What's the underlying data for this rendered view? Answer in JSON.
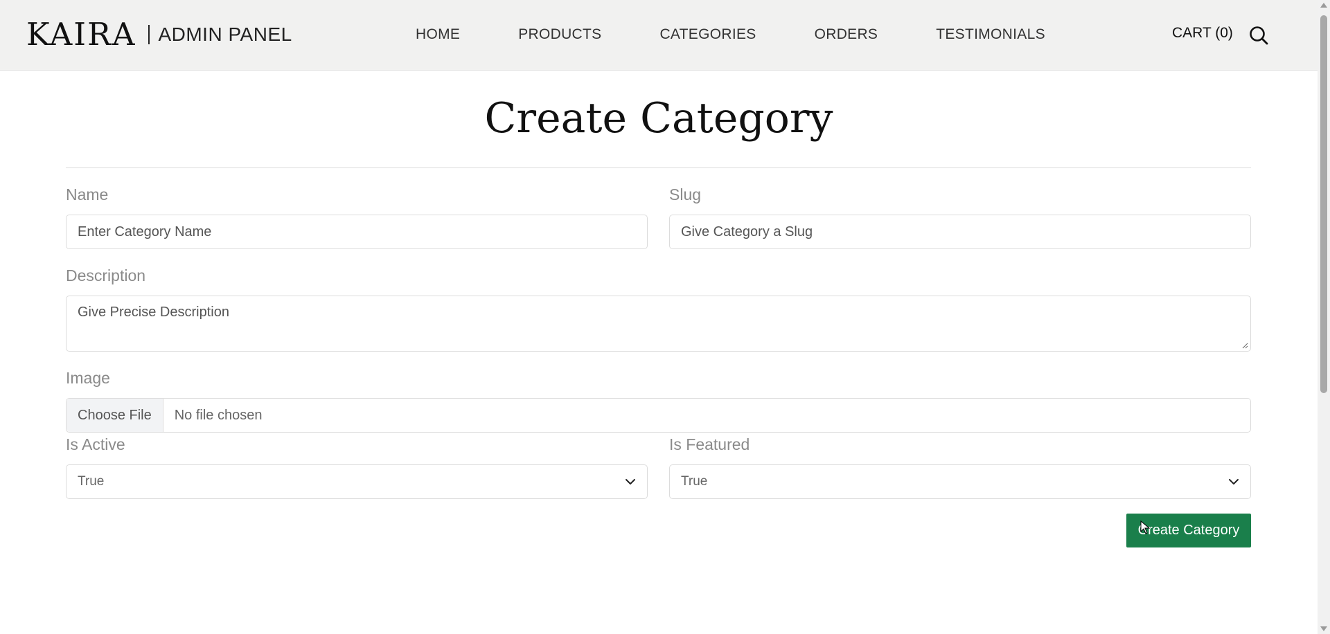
{
  "header": {
    "logo": "KAIRA",
    "subtitle": "ADMIN PANEL",
    "nav": [
      {
        "label": "HOME"
      },
      {
        "label": "PRODUCTS"
      },
      {
        "label": "CATEGORIES"
      },
      {
        "label": "ORDERS"
      },
      {
        "label": "TESTIMONIALS"
      }
    ],
    "cart": "CART (0)",
    "search_icon": "search-icon"
  },
  "form": {
    "title": "Create Category",
    "name": {
      "label": "Name",
      "placeholder": "Enter Category Name"
    },
    "slug": {
      "label": "Slug",
      "placeholder": "Give Category a Slug"
    },
    "description": {
      "label": "Description",
      "placeholder": "Give Precise Description"
    },
    "image": {
      "label": "Image",
      "button": "Choose File",
      "status": "No file chosen"
    },
    "is_active": {
      "label": "Is Active",
      "value": "True"
    },
    "is_featured": {
      "label": "Is Featured",
      "value": "True"
    },
    "submit": "Create Category"
  },
  "colors": {
    "header_bg": "#f1f1f0",
    "accent": "#1a7f4b"
  }
}
